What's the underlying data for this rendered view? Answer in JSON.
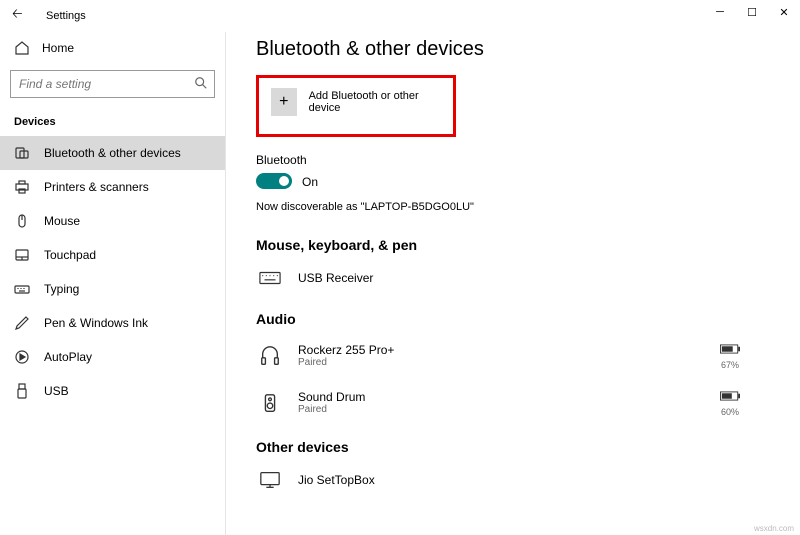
{
  "window": {
    "title": "Settings"
  },
  "sidebar": {
    "home": "Home",
    "search_placeholder": "Find a setting",
    "section_label": "Devices",
    "items": [
      {
        "label": "Bluetooth & other devices"
      },
      {
        "label": "Printers & scanners"
      },
      {
        "label": "Mouse"
      },
      {
        "label": "Touchpad"
      },
      {
        "label": "Typing"
      },
      {
        "label": "Pen & Windows Ink"
      },
      {
        "label": "AutoPlay"
      },
      {
        "label": "USB"
      }
    ]
  },
  "main": {
    "title": "Bluetooth & other devices",
    "add_label": "Add Bluetooth or other device",
    "bt_label": "Bluetooth",
    "bt_state": "On",
    "discoverable": "Now discoverable as \"LAPTOP-B5DGO0LU\"",
    "section_mkp": "Mouse, keyboard, & pen",
    "usb_receiver": "USB Receiver",
    "section_audio": "Audio",
    "audio1_name": "Rockerz 255 Pro+",
    "audio1_status": "Paired",
    "audio1_pct": "67%",
    "audio2_name": "Sound Drum",
    "audio2_status": "Paired",
    "audio2_pct": "60%",
    "section_other": "Other devices",
    "other1_name": "Jio SetTopBox"
  },
  "watermark": "wsxdn.com"
}
